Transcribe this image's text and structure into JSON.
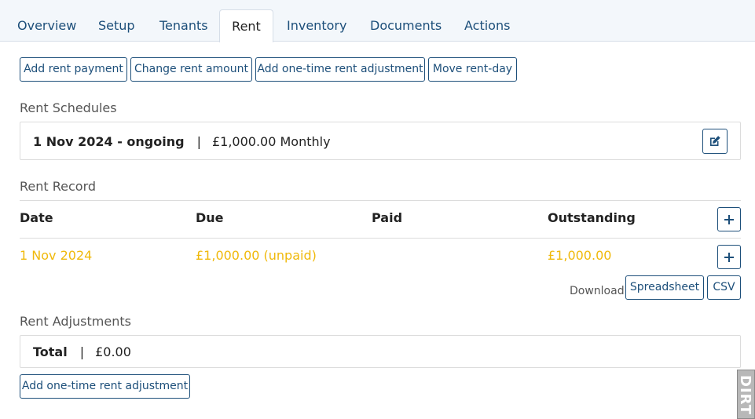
{
  "tabs": [
    {
      "label": "Overview",
      "active": false
    },
    {
      "label": "Setup",
      "active": false
    },
    {
      "label": "Tenants",
      "active": false
    },
    {
      "label": "Rent",
      "active": true
    },
    {
      "label": "Inventory",
      "active": false
    },
    {
      "label": "Documents",
      "active": false
    },
    {
      "label": "Actions",
      "active": false
    }
  ],
  "actions": {
    "add_payment": "Add rent payment",
    "change_amount": "Change rent amount",
    "add_adjustment": "Add one-time rent adjustment",
    "move_rent_day": "Move rent-day"
  },
  "schedules": {
    "title": "Rent Schedules",
    "period": "1 Nov 2024 - ongoing",
    "separator": "|",
    "amount": "£1,000.00 Monthly"
  },
  "record": {
    "title": "Rent Record",
    "columns": {
      "date": "Date",
      "due": "Due",
      "paid": "Paid",
      "outstanding": "Outstanding"
    },
    "rows": [
      {
        "date": "1 Nov 2024",
        "due": "£1,000.00 (unpaid)",
        "paid": "",
        "outstanding": "£1,000.00"
      }
    ],
    "download_label": "Download",
    "spreadsheet": "Spreadsheet",
    "csv": "CSV"
  },
  "adjustments": {
    "title": "Rent Adjustments",
    "total_label": "Total",
    "separator": "|",
    "total_value": "£0.00",
    "add_button": "Add one-time rent adjustment"
  },
  "colors": {
    "accent": "#1d4f7a",
    "unpaid": "#f0b90b"
  },
  "side_widget": {
    "text": "DIRT"
  }
}
